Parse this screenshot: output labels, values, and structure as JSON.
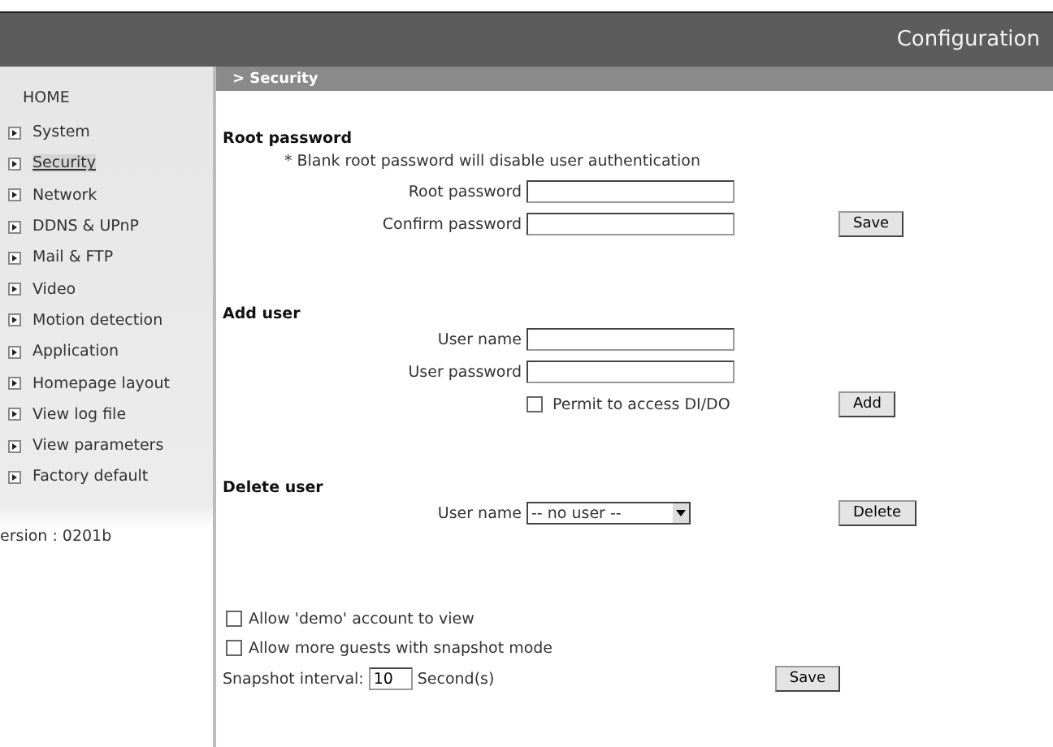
{
  "header": {
    "title": "Configuration"
  },
  "sidebar": {
    "home": "HOME",
    "items": [
      {
        "label": "System",
        "selected": false
      },
      {
        "label": "Security",
        "selected": true
      },
      {
        "label": "Network",
        "selected": false
      },
      {
        "label": "DDNS & UPnP",
        "selected": false
      },
      {
        "label": "Mail & FTP",
        "selected": false
      },
      {
        "label": "Video",
        "selected": false
      },
      {
        "label": "Motion detection",
        "selected": false
      },
      {
        "label": "Application",
        "selected": false
      },
      {
        "label": "Homepage layout",
        "selected": false
      },
      {
        "label": "View log file",
        "selected": false
      },
      {
        "label": "View parameters",
        "selected": false
      },
      {
        "label": "Factory default",
        "selected": false
      }
    ],
    "version": "ersion : 0201b"
  },
  "section_title": "> Security",
  "root_password": {
    "title": "Root password",
    "note": "* Blank root password will disable user authentication",
    "fields": [
      {
        "label": "Root password"
      },
      {
        "label": "Confirm password"
      }
    ],
    "button": "Save"
  },
  "add_user": {
    "title": "Add user",
    "fields": [
      {
        "label": "User name"
      },
      {
        "label": "User password"
      }
    ],
    "permit": {
      "label": "Permit to access DI/DO",
      "checked": false
    },
    "button": "Add"
  },
  "delete_user": {
    "title": "Delete user",
    "label": "User name",
    "select_value": "-- no user --",
    "button": "Delete"
  },
  "guest": {
    "options": [
      {
        "label": "Allow 'demo' account to view",
        "checked": false
      },
      {
        "label": "Allow more guests with snapshot mode",
        "checked": false
      }
    ],
    "interval_label": "Snapshot interval:",
    "interval_value": "10",
    "interval_unit": "Second(s)",
    "button": "Save"
  }
}
